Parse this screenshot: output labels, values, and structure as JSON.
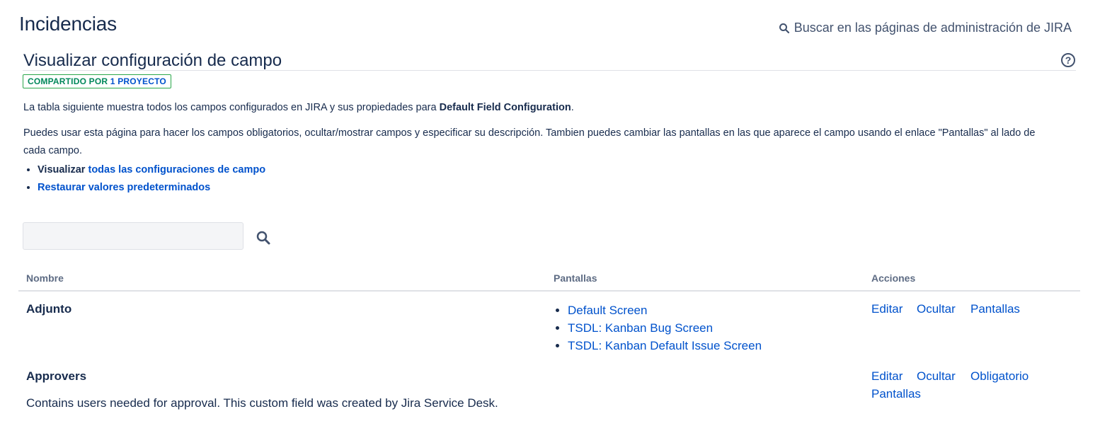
{
  "header": {
    "title": "Incidencias",
    "admin_search_label": "Buscar en las páginas de administración de JIRA"
  },
  "page": {
    "subtitle": "Visualizar configuración de campo",
    "shared_badge_prefix": "COMPARTIDO POR",
    "shared_badge_link": "1 PROYECTO",
    "intro_text": "La tabla siguiente muestra todos los campos configurados en JIRA y sus propiedades para",
    "intro_config_name": "Default Field Configuration",
    "intro_end": ".",
    "help_text": "Puedes usar esta página para hacer los campos obligatorios, ocultar/mostrar campos y especificar su descripción. Tambien puedes cambiar las pantallas en las que aparece el campo usando el enlace \"Pantallas\" al lado de cada campo.",
    "view_all_prefix": "Visualizar",
    "view_all_link": "todas las configuraciones de campo",
    "restore_defaults_link": "Restaurar valores predeterminados"
  },
  "filter": {
    "value": "",
    "placeholder": ""
  },
  "table": {
    "headers": {
      "name": "Nombre",
      "screens": "Pantallas",
      "actions": "Acciones"
    },
    "rows": [
      {
        "name": "Adjunto",
        "description": "",
        "screens": [
          "Default Screen",
          "TSDL: Kanban Bug Screen",
          "TSDL: Kanban Default Issue Screen"
        ],
        "actions": [
          "Editar",
          "Ocultar",
          "Pantallas"
        ]
      },
      {
        "name": "Approvers",
        "description": "Contains users needed for approval. This custom field was created by Jira Service Desk.",
        "screens": [],
        "actions": [
          "Editar",
          "Ocultar",
          "Obligatorio",
          "Pantallas"
        ]
      }
    ]
  },
  "icons": {
    "admin_search": "search-icon",
    "help": "help-icon",
    "filter_search": "search-icon"
  },
  "colors": {
    "link": "#0052cc",
    "text": "#172b4d",
    "badge_border": "#2aa74a",
    "badge_green": "#00875a"
  }
}
